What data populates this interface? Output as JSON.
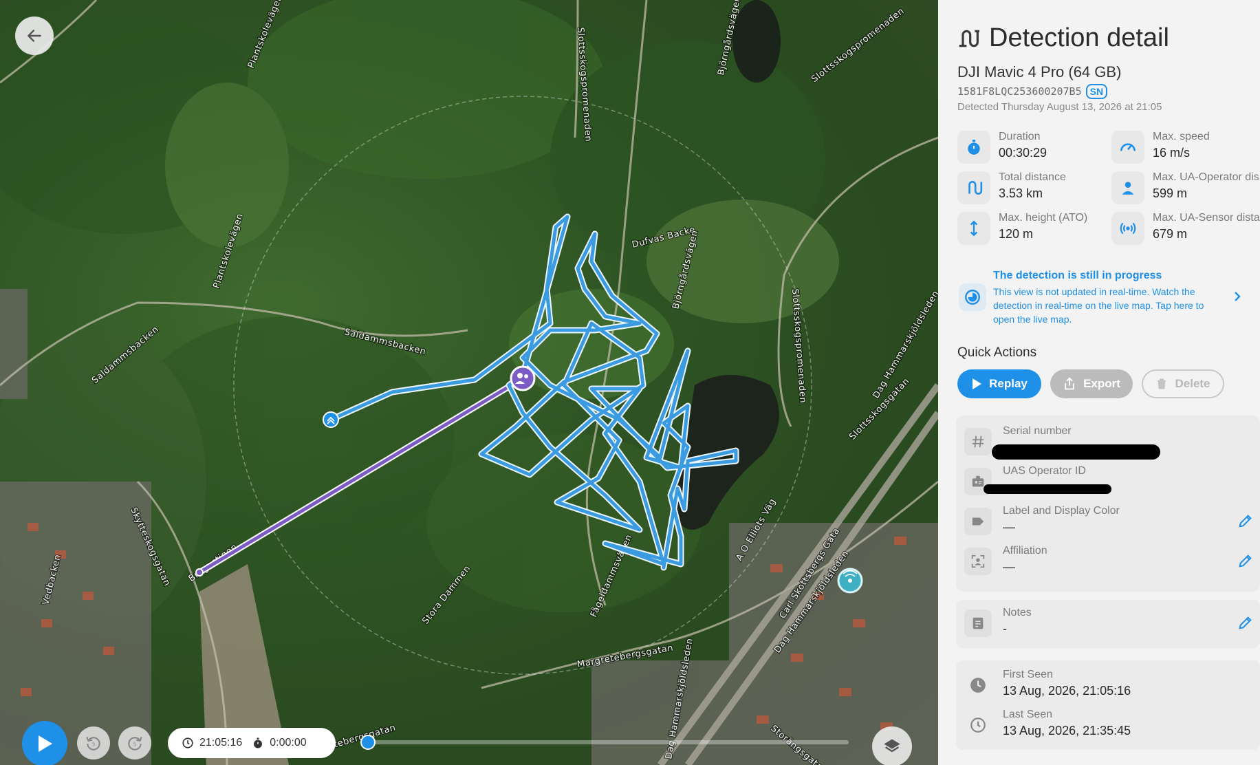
{
  "map": {
    "road_labels": [
      {
        "text": "Plantskolevägen"
      },
      {
        "text": "Plantskolevägen"
      },
      {
        "text": "Saldammsbacken"
      },
      {
        "text": "Saldammsbacken"
      },
      {
        "text": "Dufvas Backe"
      },
      {
        "text": "Björngårdsvägen"
      },
      {
        "text": "Björngårdsvägen"
      },
      {
        "text": "Slottsskogspromenaden"
      },
      {
        "text": "Slottsskogspromenaden"
      },
      {
        "text": "Slottsskogspromenaden"
      },
      {
        "text": "Slottsskogsgatan"
      },
      {
        "text": "Skytteskogsgatan"
      },
      {
        "text": "Vedbacken"
      },
      {
        "text": "Bragestigen"
      },
      {
        "text": "Stora Dammen"
      },
      {
        "text": "Fågeldammsvägen"
      },
      {
        "text": "Dag Hammarskjöldsleden"
      },
      {
        "text": "Dag Hammarskjöldsleden"
      },
      {
        "text": "A O Elliots Väg"
      },
      {
        "text": "Carl Skottsbergs Gata"
      },
      {
        "text": "Margretebergsgatan"
      },
      {
        "text": "Margretebergsgatan"
      },
      {
        "text": "Storängsgatan"
      },
      {
        "text": "Dag Hammarskjöldsleden"
      }
    ]
  },
  "player": {
    "clock_time": "21:05:16",
    "elapsed": "0:00:00",
    "progress_fraction": 0.0
  },
  "panel": {
    "title": "Detection detail",
    "device_name": "DJI Mavic 4 Pro (64 GB)",
    "serial": "1581F8LQC253600207B5",
    "serial_badge": "SN",
    "detected": "Detected Thursday August 13, 2026 at 21:05",
    "stats": {
      "duration": {
        "label": "Duration",
        "value": "00:30:29"
      },
      "max_speed": {
        "label": "Max. speed",
        "value": "16 m/s"
      },
      "total_distance": {
        "label": "Total distance",
        "value": "3.53 km"
      },
      "max_ua_operator": {
        "label": "Max. UA-Operator dis",
        "value": "599 m"
      },
      "max_height": {
        "label": "Max. height (ATO)",
        "value": "120 m"
      },
      "max_ua_sensor": {
        "label": "Max. UA-Sensor dista",
        "value": "679 m"
      }
    },
    "in_progress": {
      "title": "The detection is still in progress",
      "body": "This view is not updated in real-time. Watch the detection in real-time on the live map. Tap here to open the live map."
    },
    "quick_actions": {
      "title": "Quick Actions",
      "replay": "Replay",
      "export": "Export",
      "delete": "Delete"
    },
    "fields": {
      "serial_number": {
        "label": "Serial number",
        "value": ""
      },
      "uas_operator_id": {
        "label": "UAS Operator ID",
        "value": ""
      },
      "label_color": {
        "label": "Label and Display Color",
        "value": "—"
      },
      "affiliation": {
        "label": "Affiliation",
        "value": "—"
      },
      "notes": {
        "label": "Notes",
        "value": "-"
      },
      "first_seen": {
        "label": "First Seen",
        "value": "13 Aug, 2026, 21:05:16"
      },
      "last_seen": {
        "label": "Last Seen",
        "value": "13 Aug, 2026, 21:35:45"
      }
    },
    "colors": {
      "accent": "#1e90e8",
      "flight_path": "#3a9be0",
      "operator_line": "#7b5cc4"
    }
  }
}
